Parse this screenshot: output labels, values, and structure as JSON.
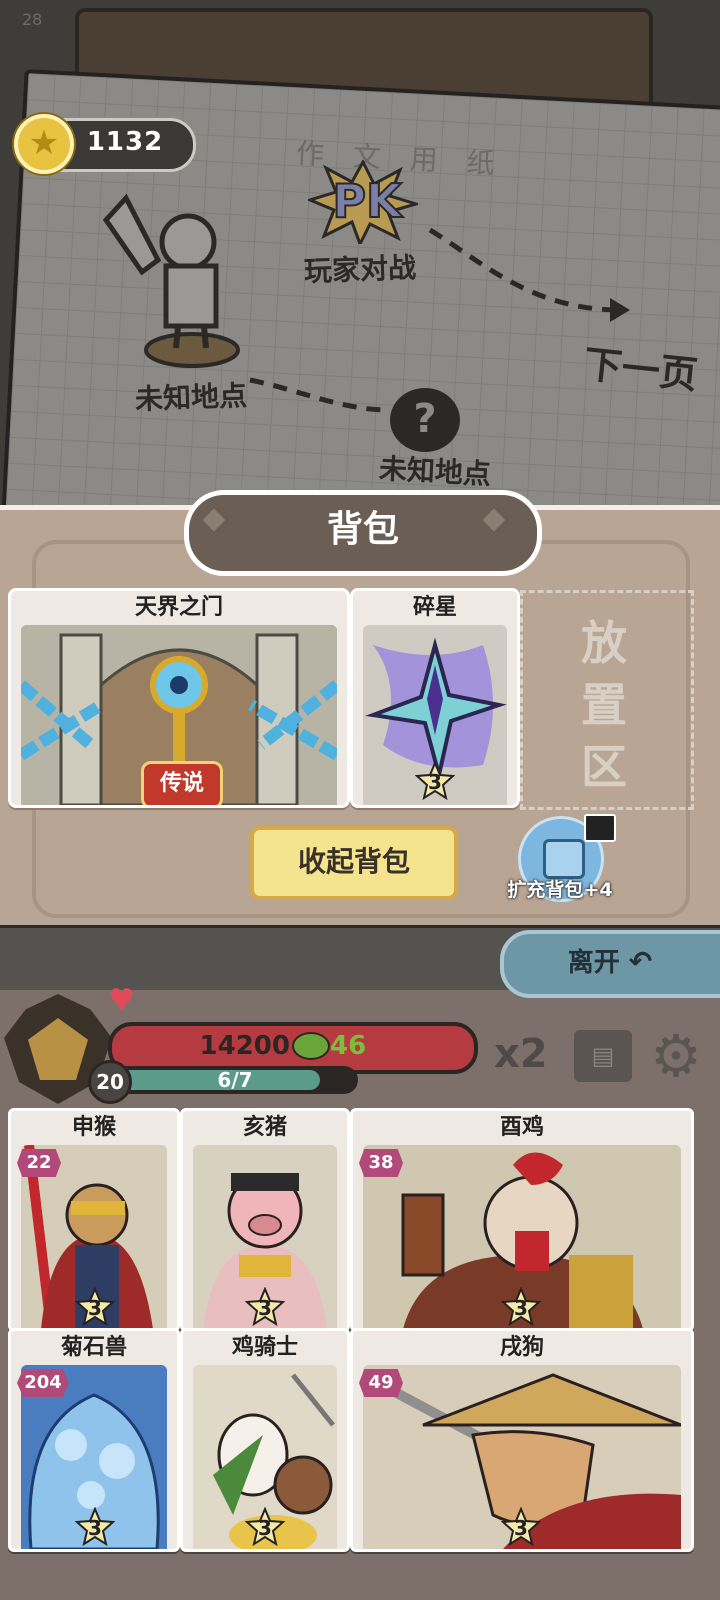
{
  "status": {
    "fps": "28"
  },
  "currency": {
    "coins": "1132",
    "icon": "coin-star-icon"
  },
  "map": {
    "pk_badge": "PK",
    "nodes": [
      {
        "label": "玩家对战"
      },
      {
        "label": "未知地点"
      },
      {
        "label": "未知地点"
      }
    ],
    "next_page": "下一页",
    "paper_text": "作 文 用 纸"
  },
  "backpack": {
    "title": "背包",
    "items": [
      {
        "name": "天界之门",
        "rarity": "传说",
        "stars": ""
      },
      {
        "name": "碎星",
        "rarity": "",
        "stars": "3"
      }
    ],
    "drop_zone": "放置区",
    "collapse_label": "收起背包",
    "expand_label": "扩充背包+4"
  },
  "battle": {
    "leave_label": "离开",
    "player": {
      "hp": "14200",
      "shield": "46",
      "level": "20",
      "xp": "6/7",
      "xp_fraction": 0.857
    },
    "speed": "x2",
    "units": [
      {
        "name": "申猴",
        "level": "22",
        "stars": "3"
      },
      {
        "name": "亥猪",
        "level": "",
        "stars": "3"
      },
      {
        "name": "酉鸡",
        "level": "38",
        "stars": "3"
      },
      {
        "name": "菊石兽",
        "level": "204",
        "stars": "3"
      },
      {
        "name": "鸡骑士",
        "level": "",
        "stars": "3"
      },
      {
        "name": "戌狗",
        "level": "49",
        "stars": "3"
      }
    ]
  },
  "colors": {
    "accent_yellow": "#f4e48e",
    "hp_red": "#b53b40",
    "shield_green": "#7cbd3d",
    "legend_badge": "#c0392b"
  }
}
